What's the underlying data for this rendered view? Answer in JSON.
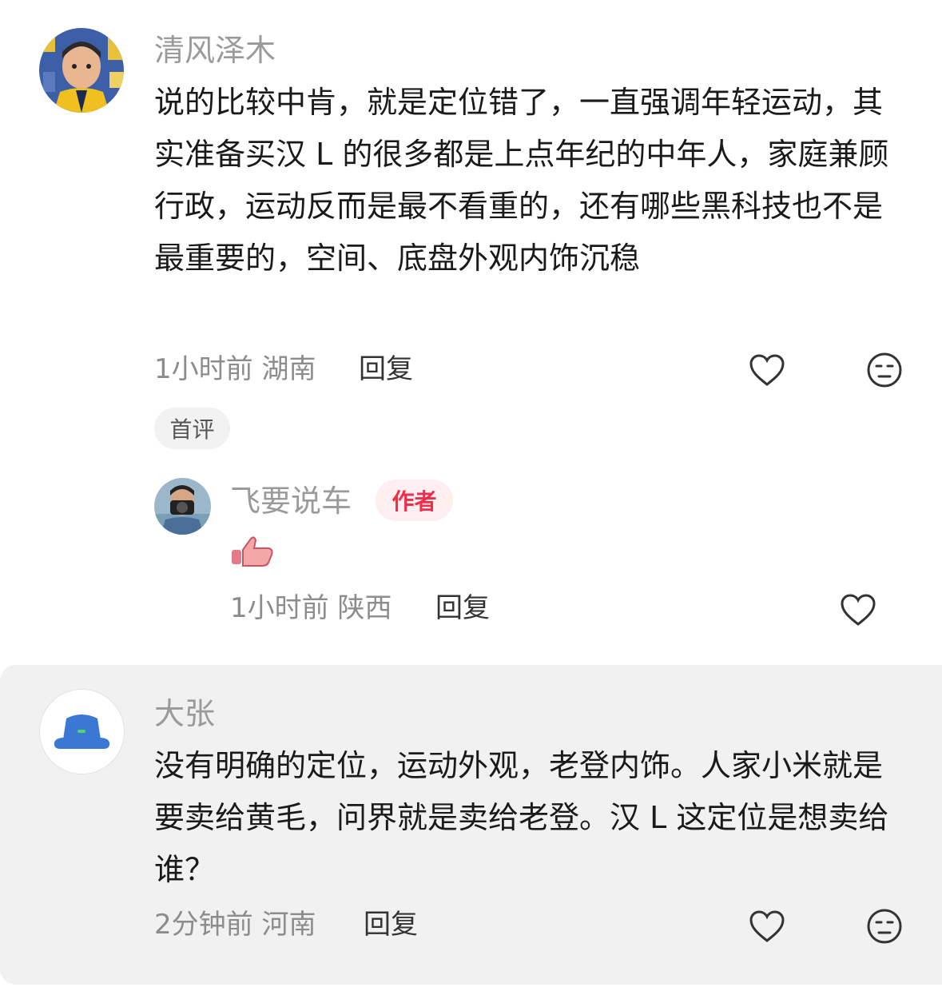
{
  "comments": [
    {
      "username": "清风泽木",
      "text": "说的比较中肯，就是定位错了，一直强调年轻运动，其实准备买汉 L 的很多都是上点年纪的中年人，家庭兼顾行政，运动反而是最不看重的，还有哪些黑科技也不是最重要的，空间、底盘外观内饰沉稳",
      "meta": "1小时前 湖南",
      "reply_label": "回复",
      "badge": "首评",
      "avatar_icon": "boy-avatar-icon"
    },
    {
      "username": "飞要说车",
      "author_badge": "作者",
      "text": "👍",
      "meta": "1小时前 陕西",
      "reply_label": "回复",
      "avatar_icon": "photographer-avatar-icon"
    },
    {
      "username": "大张",
      "text": "没有明确的定位，运动外观，老登内饰。人家小米就是要卖给黄毛，问界就是卖给老登。汉 L 这定位是想卖给谁？",
      "meta": "2分钟前 河南",
      "reply_label": "回复",
      "avatar_icon": "bucket-hat-avatar-icon"
    }
  ],
  "colors": {
    "author_badge": "#f02d4b",
    "highlight_bg": "#f1f1f1"
  }
}
